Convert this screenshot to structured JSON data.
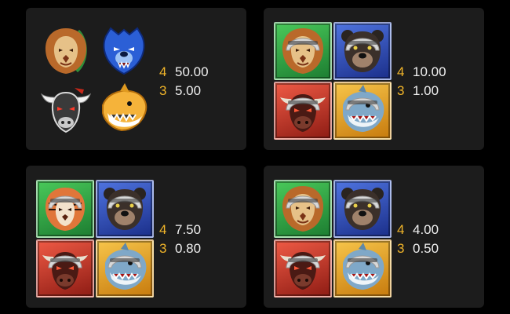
{
  "palette": {
    "panel": "#1c1c1c",
    "count_color": "#f0b429",
    "value_color": "#f0f0f0",
    "tile_green": "#2ea343",
    "tile_blue": "#2c4bbd",
    "tile_red": "#c8321f",
    "tile_yellow": "#f0a21c"
  },
  "panels": [
    {
      "symbols": [
        "lion-logo-icon",
        "bear-logo-icon",
        "bull-logo-icon",
        "shark-logo-icon"
      ],
      "pays": [
        {
          "count": "4",
          "value": "50.00"
        },
        {
          "count": "3",
          "value": "5.00"
        }
      ]
    },
    {
      "symbols": [
        "lion-player-icon",
        "bear-player-icon",
        "bull-player-icon",
        "shark-player-icon"
      ],
      "pays": [
        {
          "count": "4",
          "value": "10.00"
        },
        {
          "count": "3",
          "value": "1.00"
        }
      ]
    },
    {
      "symbols": [
        "tiger-player-icon",
        "bear-player-icon",
        "bull-player-icon",
        "shark-player-icon"
      ],
      "pays": [
        {
          "count": "4",
          "value": "7.50"
        },
        {
          "count": "3",
          "value": "0.80"
        }
      ]
    },
    {
      "symbols": [
        "lion-player-icon",
        "bear-player-icon",
        "bull-player-icon",
        "shark-player-icon"
      ],
      "pays": [
        {
          "count": "4",
          "value": "4.00"
        },
        {
          "count": "3",
          "value": "0.50"
        }
      ]
    }
  ]
}
